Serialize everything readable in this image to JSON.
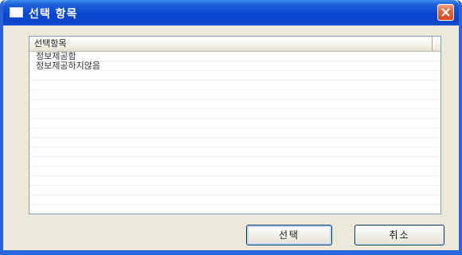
{
  "window": {
    "title": "선택 항목",
    "icon": "window-icon",
    "close_icon": "close-x-icon"
  },
  "list": {
    "column_header": "선택항목",
    "items": [
      "정보제공함",
      "정보제공하지않음"
    ]
  },
  "buttons": {
    "select_label": "선택",
    "cancel_label": "취소"
  },
  "colors": {
    "titlebar": "#0a47d0",
    "close_button": "#e0623a",
    "dialog_background": "#ece9d8"
  }
}
